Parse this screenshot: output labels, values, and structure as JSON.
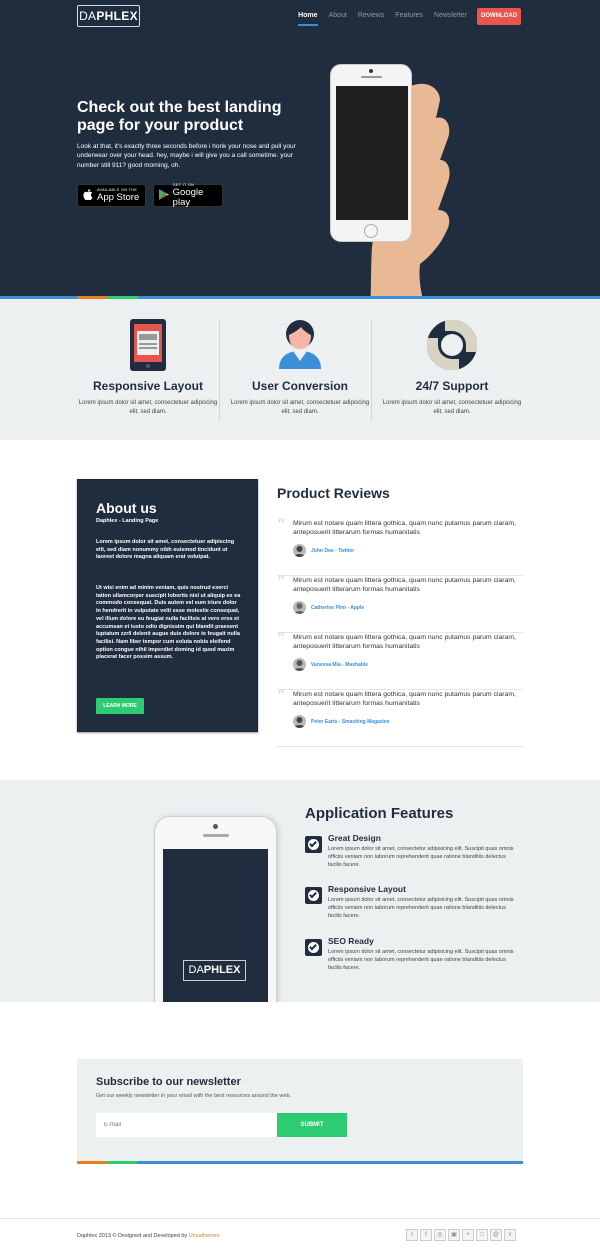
{
  "header": {
    "logo_part1": "DA",
    "logo_part2": "PHLEX",
    "nav": [
      "Home",
      "About",
      "Reviews",
      "Features",
      "Newsletter"
    ],
    "download_label": "DOWNLOAD"
  },
  "hero": {
    "title": "Check out the best landing page for your product",
    "text": "Look at that, it's exactly three seconds before i honk your nose and pull your underwear over your head. hey, maybe i will give you a call sometime. your number still 911? good morning, oh.",
    "appstore_small": "AVAILABLE ON THE",
    "appstore_big": "App Store",
    "google_small": "GET IT ON",
    "google_big": "Google play"
  },
  "features": [
    {
      "title": "Responsive Layout",
      "text": "Lorem ipsum dolor sit amet, consectetuer adipiscing elit, sed diam."
    },
    {
      "title": "User Conversion",
      "text": "Lorem ipsum dolor sit amet, consectetuer adipiscing elit, sed diam."
    },
    {
      "title": "24/7 Support",
      "text": "Lorem ipsum dolor sit amet, consectetuer adipiscing elit, sed diam."
    }
  ],
  "about": {
    "title": "About us",
    "subtitle": "Daphlex - Landing Page",
    "p1": "Lorem ipsum dolor sit amet, consectetuer adipiscing elit, sed diam nonummy nibh euismod tincidunt ut laoreet dolore magna aliquam erat volutpat.",
    "p2": "Ut wisi enim ad minim veniam, quis nostrud exerci tation ullamcorper suscipit lobortis nisl ut aliquip ex ea commodo consequat. Duis autem vel eum iriure dolor in hendrerit in vulputate velit esse molestie consequat, vel illum dolore eu feugiat nulla facilisis at vero eros et accumsan et iusto odio dignissim qui blandit praesent luptatum zzril delenit augue duis dolore te feugait nulla facilisi. Nam liber tempor cum soluta nobis eleifend option congue nihil imperdiet doming id quod mazim placerat facer possim assum.",
    "button": "LEARN MORE"
  },
  "reviews": {
    "title": "Product Reviews",
    "items": [
      {
        "text": "Mirum est notare quam littera gothica, quam nunc putamus parum claram, anteposuerit litterarum formas humanitatis",
        "author": "John Doe - Twitter"
      },
      {
        "text": "Mirum est notare quam littera gothica, quam nunc putamus parum claram, anteposuerit litterarum formas humanitatis",
        "author": "Catherine Pilm - Apple"
      },
      {
        "text": "Mirum est notare quam littera gothica, quam nunc putamus parum claram, anteposuerit litterarum formas humanitatis",
        "author": "Vanessa Mia - Mashable"
      },
      {
        "text": "Mirum est notare quam littera gothica, quam nunc putamus parum claram, anteposuerit litterarum formas humanitatis",
        "author": "Peter Earts - Smashing Magazine"
      }
    ]
  },
  "app": {
    "title": "Application Features",
    "phone_logo_1": "DA",
    "phone_logo_2": "PHLEX",
    "items": [
      {
        "title": "Great Design",
        "text": "Lorem ipsum dolor sit amet, consectetur adipisicing elit. Suscipit quas omnis officiis veniam non laborum reprehenderit quae ratione blanditiis delectus facilis facere."
      },
      {
        "title": "Responsive Layout",
        "text": "Lorem ipsum dolor sit amet, consectetur adipisicing elit. Suscipit quas omnis officiis veniam non laborum reprehenderit quae ratione blanditiis delectus facilis facere."
      },
      {
        "title": "SEO Ready",
        "text": "Lorem ipsum dolor sit amet, consectetur adipisicing elit. Suscipit quas omnis officiis veniam non laborum reprehenderit quae ratione blanditiis delectus facilis facere."
      }
    ]
  },
  "newsletter": {
    "title": "Subscribe to our newsletter",
    "subtitle": "Get our weekly newsletter in your email with the best resources around the web.",
    "placeholder": "E-mail",
    "button": "SUBMIT"
  },
  "footer": {
    "copy": "Daphlex 2013 © Designed and Developed by ",
    "brand": "Unzathemes"
  },
  "icons": {
    "social": [
      "twitter-icon",
      "facebook-icon",
      "dribbble-icon",
      "instagram-icon",
      "plus-icon",
      "flickr-icon",
      "at-icon",
      "vimeo-icon"
    ]
  },
  "colors": {
    "navy": "#1f2d3f",
    "accent_blue": "#3d8ed9",
    "accent_red": "#e8554d",
    "accent_green": "#2ecc71",
    "accent_orange": "#e67e22",
    "light_bg": "#ecf0f1"
  }
}
